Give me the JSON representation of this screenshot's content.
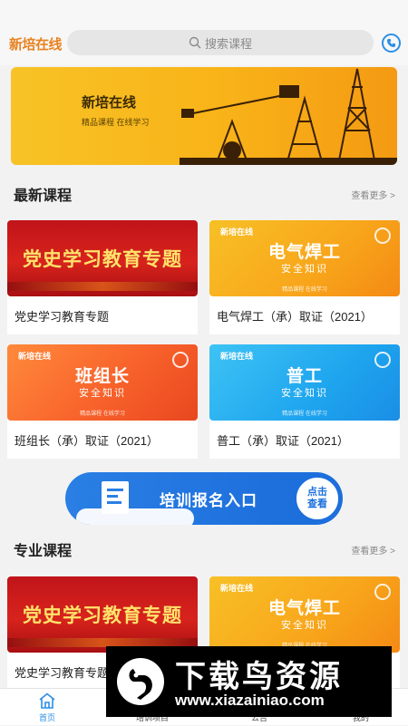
{
  "header": {
    "logo_text": "新培在线",
    "search_placeholder": "搜索课程",
    "phone_icon": "phone-icon"
  },
  "banner": {
    "title": "新培在线",
    "subtitle": "精品课程 在线学习"
  },
  "latest": {
    "title": "最新课程",
    "more": "查看更多 >",
    "courses": [
      {
        "thumb_title": "党史学习教育专题",
        "caption": "党史学习教育专题"
      },
      {
        "brand": "新培在线",
        "thumb_title": "电气焊工",
        "thumb_sub": "安全知识",
        "tag": "精品课程 在线学习",
        "caption": "电气焊工（承）取证（2021）"
      },
      {
        "brand": "新培在线",
        "thumb_title": "班组长",
        "thumb_sub": "安全知识",
        "tag": "精品课程 在线学习",
        "caption": "班组长（承）取证（2021）"
      },
      {
        "brand": "新培在线",
        "thumb_title": "普工",
        "thumb_sub": "安全知识",
        "tag": "精品课程 在线学习",
        "caption": "普工（承）取证（2021）"
      }
    ]
  },
  "signup_banner": {
    "text": "培训报名入口",
    "button": "点击查看"
  },
  "professional": {
    "title": "专业课程",
    "more": "查看更多 >",
    "courses": [
      {
        "thumb_title": "党史学习教育专题",
        "caption": "党史学习教育专题"
      },
      {
        "brand": "新培在线",
        "thumb_title": "电气焊工",
        "thumb_sub": "安全知识",
        "tag": "精品课程 在线学习",
        "caption": ""
      }
    ]
  },
  "tabbar": {
    "items": [
      {
        "label": "首页",
        "active": true
      },
      {
        "label": "培训项目",
        "active": false
      },
      {
        "label": "公告",
        "active": false
      },
      {
        "label": "我的",
        "active": false
      }
    ]
  },
  "watermark": {
    "title": "下载鸟资源",
    "url": "www.xiazainiao.com"
  },
  "colors": {
    "accent": "#2b8fe6",
    "logo": "#e8821f"
  }
}
